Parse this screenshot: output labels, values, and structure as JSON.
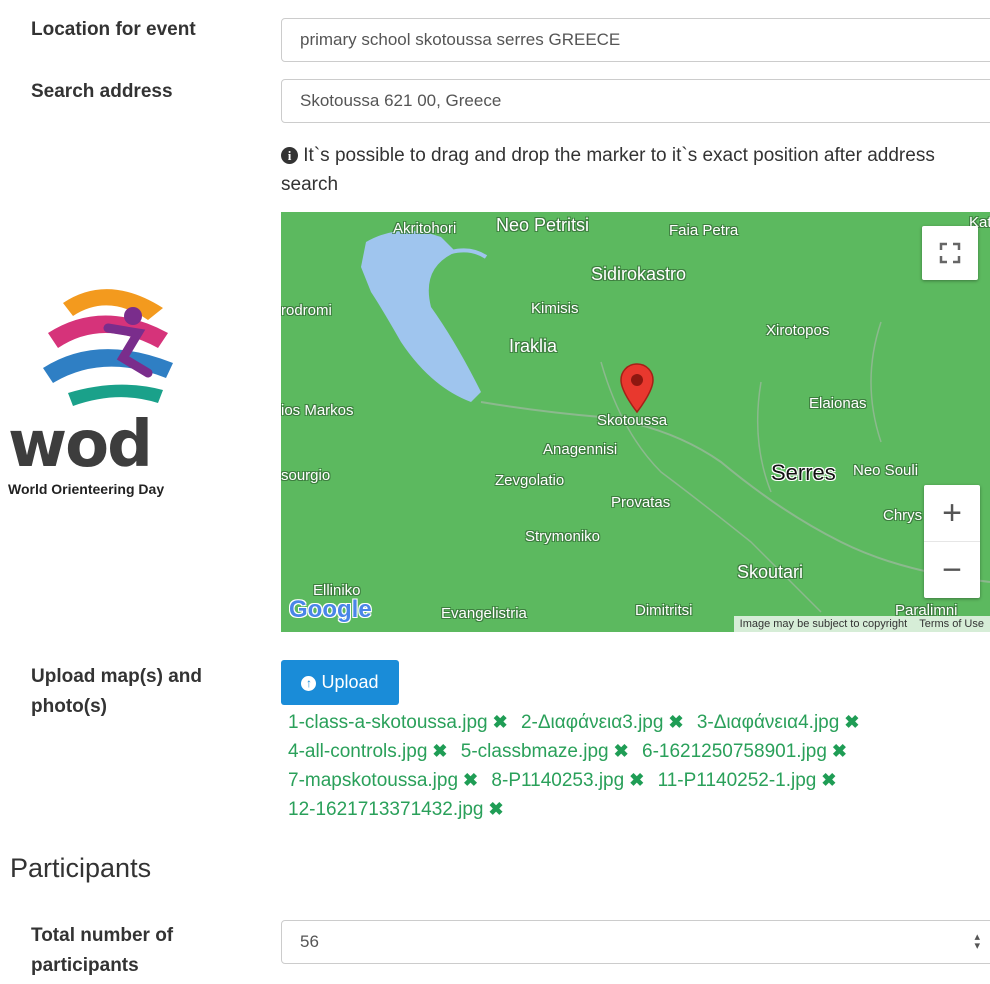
{
  "location": {
    "label": "Location for event",
    "value": "primary school skotoussa serres GREECE"
  },
  "search": {
    "label": "Search address",
    "value": "Skotoussa 621 00, Greece"
  },
  "hint": {
    "icon": "info-circle-icon",
    "text": "It`s possible to drag and drop the marker to it`s exact position after address search"
  },
  "logo": {
    "wordmark": "wod",
    "caption": "World Orienteering Day"
  },
  "map": {
    "places": {
      "akritohori": "Akritohori",
      "neo_petritsi": "Neo Petritsi",
      "faia_petra": "Faia Petra",
      "kat": "Kat",
      "sidirokastro": "Sidirokastro",
      "rodromi": "rodromi",
      "kimisis": "Kimisis",
      "xirotopos": "Xirotopos",
      "iraklia": "Iraklia",
      "markos": "ios Markos",
      "skotoussa": "Skotoussa",
      "elaionas": "Elaionas",
      "anagennisi": "Anagennisi",
      "sourgio": "sourgio",
      "serres": "Serres",
      "neo_souli": "Neo Souli",
      "zevgolatio": "Zevgolatio",
      "provatas": "Provatas",
      "chrys": "Chrys",
      "strymoniko": "Strymoniko",
      "skoutari": "Skoutari",
      "elliniko": "Elliniko",
      "evangelistria": "Evangelistria",
      "dimitritsi": "Dimitritsi",
      "paralimni": "Paralimni"
    },
    "google": "Google",
    "copyright": "Image may be subject to copyright",
    "terms": "Terms of Use",
    "zoom_in": "+",
    "zoom_out": "−"
  },
  "upload": {
    "label": "Upload map(s) and photo(s)",
    "button": "Upload",
    "files": [
      "1-class-a-skotoussa.jpg",
      "2-Διαφάνεια3.jpg",
      "3-Διαφάνεια4.jpg",
      "4-all-controls.jpg",
      "5-classbmaze.jpg",
      "6-1621250758901.jpg",
      "7-mapskotoussa.jpg",
      "8-P1140253.jpg",
      "11-P1140252-1.jpg",
      "12-1621713371432.jpg"
    ]
  },
  "participants": {
    "heading": "Participants",
    "total_label": "Total number of participants",
    "total_value": "56"
  },
  "colors": {
    "upload_button": "#1a8cd8",
    "file_link": "#2aa05a",
    "map_land": "#5cb95f",
    "map_water": "#9fc5ee"
  }
}
